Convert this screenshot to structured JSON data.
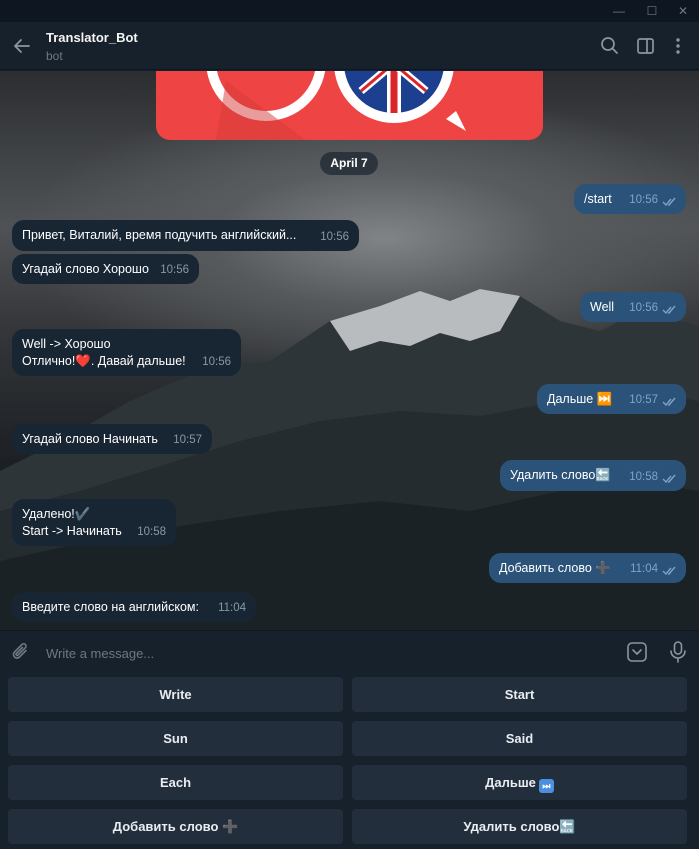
{
  "window": {
    "minimize": "—",
    "maximize": "☐",
    "close": "✕"
  },
  "header": {
    "title": "Translator_Bot",
    "subtitle": "bot",
    "icons": [
      "back-arrow-icon",
      "search-icon",
      "sidebar-toggle-icon",
      "more-icon"
    ]
  },
  "chat": {
    "date": "April 7",
    "messages": [
      {
        "dir": "out",
        "text": "/start",
        "time": "10:56"
      },
      {
        "dir": "in",
        "text": "Привет, Виталий, время подучить английский...",
        "time": "10:56"
      },
      {
        "dir": "in",
        "text": "Угадай слово Хорошо",
        "time": "10:56"
      },
      {
        "dir": "out",
        "text": "Well",
        "time": "10:56"
      },
      {
        "dir": "in",
        "text_line1": "Well -> Хорошо",
        "text_line2": "Отлично!❤️. Давай дальше!",
        "time": "10:56"
      },
      {
        "dir": "out",
        "text": "Дальше ⏭️",
        "time": "10:57"
      },
      {
        "dir": "in",
        "text": "Угадай слово Начинать",
        "time": "10:57"
      },
      {
        "dir": "out",
        "text": "Удалить слово🔙",
        "time": "10:58"
      },
      {
        "dir": "in",
        "text_line1": "Удалено!✔️",
        "text_line2": "Start -> Начинать",
        "time": "10:58"
      },
      {
        "dir": "out",
        "text": "Добавить слово ➕",
        "time": "11:04"
      },
      {
        "dir": "in",
        "text": "Введите слово на английском:",
        "time": "11:04"
      }
    ]
  },
  "composer": {
    "placeholder": "Write a message...",
    "icons": [
      "attach-icon",
      "bot-keyboard-icon",
      "microphone-icon"
    ]
  },
  "keyboard": {
    "rows": [
      [
        "Write",
        "Start"
      ],
      [
        "Sun",
        "Said"
      ],
      [
        "Each",
        "Дальше"
      ],
      [
        "Добавить слово ➕",
        "Удалить слово🔙"
      ]
    ],
    "next_emoji": "⏭"
  },
  "colors": {
    "bubble_in": "#182533",
    "bubble_out": "#2b5278",
    "background": "#17212b",
    "button": "#232e3c",
    "banner": "#ef4444"
  }
}
